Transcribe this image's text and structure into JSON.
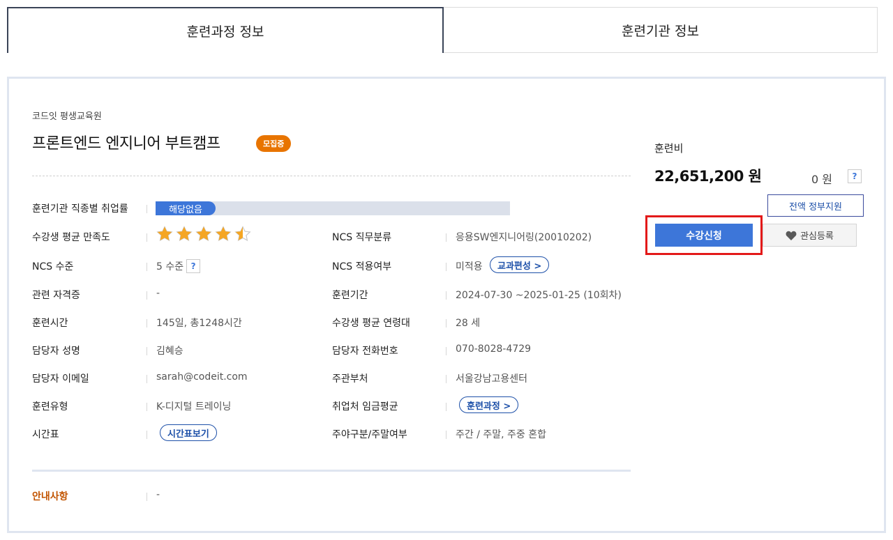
{
  "tabs": [
    {
      "label": "훈련과정 정보"
    },
    {
      "label": "훈련기관 정보"
    }
  ],
  "course": {
    "org_name": "코드잇 평생교육원",
    "title": "프론트엔드 엔지니어 부트캠프",
    "status_badge": "모집중"
  },
  "info": {
    "employment_rate": {
      "label": "훈련기관 직종별 취업률",
      "value": "해당없음"
    },
    "satisfaction": {
      "label": "수강생 평균 만족도",
      "rating": 4.5,
      "max": 5
    },
    "ncs_category": {
      "label": "NCS 직무분류",
      "value": "응용SW엔지니어링(20010202)"
    },
    "ncs_level": {
      "label": "NCS 수준",
      "value": "5 수준",
      "help": "?"
    },
    "ncs_applied": {
      "label": "NCS 적용여부",
      "value": "미적용",
      "button": "교과편성 >"
    },
    "certificate": {
      "label": "관련 자격증",
      "value": "-"
    },
    "period": {
      "label": "훈련기간",
      "value": "2024-07-30 ~2025-01-25 (10회차)"
    },
    "hours": {
      "label": "훈련시간",
      "value": "145일, 총1248시간"
    },
    "age": {
      "label": "수강생 평균 연령대",
      "value": "28 세"
    },
    "manager_name": {
      "label": "담당자 성명",
      "value": "김혜승"
    },
    "manager_phone": {
      "label": "담당자 전화번호",
      "value": "070-8028-4729"
    },
    "manager_email": {
      "label": "담당자 이메일",
      "value": "sarah@codeit.com"
    },
    "agency": {
      "label": "주관부처",
      "value": "서울강남고용센터"
    },
    "training_type": {
      "label": "훈련유형",
      "value": "K-디지털 트레이닝"
    },
    "wage": {
      "label": "취업처 임금평균",
      "button": "훈련과정 >"
    },
    "timetable": {
      "label": "시간표",
      "button": "시간표보기"
    },
    "day_type": {
      "label": "주야구분/주말여부",
      "value": "주간 / 주말, 주중 혼합"
    },
    "notice": {
      "label": "안내사항",
      "value": "-"
    }
  },
  "fee": {
    "label": "훈련비",
    "amount": "22,651,200 원",
    "self_pay": "0 원",
    "help": "?",
    "gov_button": "전액 정부지원"
  },
  "actions": {
    "apply": "수강신청",
    "wishlist": "관심등록"
  },
  "colors": {
    "accent": "#3d76d9",
    "badge": "#e87400",
    "highlight": "#e31919",
    "notice": "#c25400"
  }
}
